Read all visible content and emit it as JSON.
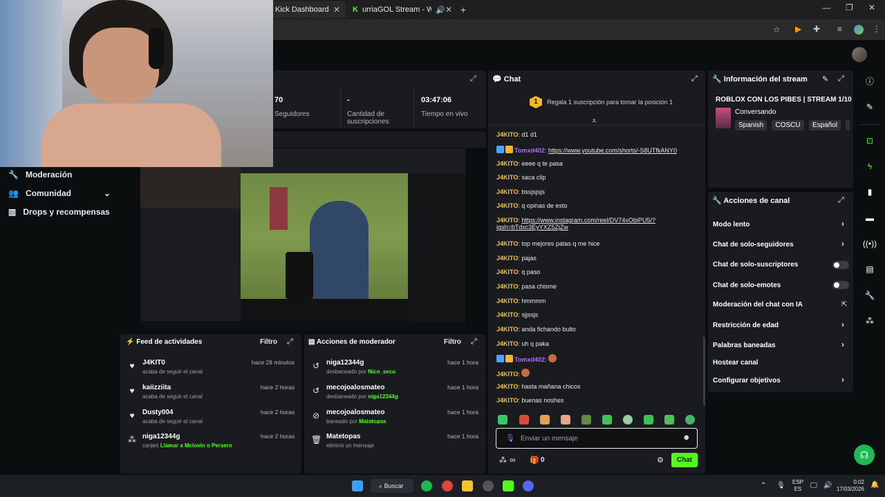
{
  "browser": {
    "tabs": [
      {
        "label": "Kick Dashboard"
      },
      {
        "label": "urriaGOL Stream - Watch Li"
      }
    ]
  },
  "nav": {
    "items": [
      {
        "label": "Moderación"
      },
      {
        "label": "Comunidad"
      },
      {
        "label": "Drops y recompensas"
      }
    ]
  },
  "stats": {
    "followers_value": "70",
    "followers_label": "Seguidores",
    "subs_value": "-",
    "subs_label": "Cantidad de suscripciones",
    "live_value": "03:47:06",
    "live_label": "Tiempo en vivo"
  },
  "activity_feed": {
    "title": "Feed de actividades",
    "filter": "Filtro",
    "items": [
      {
        "name": "J4KIT0",
        "sub": "acaba de seguir el canal",
        "time": "hace 28 minutos",
        "icon": "heart-icon"
      },
      {
        "name": "kaiizziita",
        "sub": "acaba de seguir el canal",
        "time": "hace 2 horas",
        "icon": "heart-icon"
      },
      {
        "name": "Dusty004",
        "sub": "acaba de seguir el canal",
        "time": "hace 2 horas",
        "icon": "heart-icon"
      },
      {
        "name": "niga12344g",
        "sub_prefix": "canjeó",
        "sub_highlight": "Llamar a Mclovin o Persero",
        "time": "hace 2 horas",
        "icon": "points-icon"
      }
    ]
  },
  "mod_actions": {
    "title": "Acciones de moderador",
    "filter": "Filtro",
    "items": [
      {
        "name": "niga12344g",
        "sub_prefix": "desbaneado por",
        "sub_highlight": "Nico_secu",
        "time": "hace 1 hora"
      },
      {
        "name": "mecojoalosmateo",
        "sub_prefix": "desbaneado por",
        "sub_highlight": "niga12344g",
        "time": "hace 1 hora"
      },
      {
        "name": "mecojoalosmateo",
        "sub_prefix": "baneado por",
        "sub_highlight": "Matetopas",
        "time": "hace 1 hora"
      },
      {
        "name": "Matetopas",
        "sub_prefix": "eliminó un mensaje",
        "sub_highlight": "",
        "time": "hace 1 hora"
      }
    ]
  },
  "chat": {
    "title": "Chat",
    "gift_rank": "1",
    "gift_text": "Regala 1 suscripción para tomar la posición 1",
    "messages": [
      {
        "user": "J4KITO",
        "text": "d1 d1"
      },
      {
        "user": "Tomxd402",
        "text": "https://www.youtube.com/shorts/-S8UTfkANY0",
        "link": true,
        "special": true
      },
      {
        "user": "J4KITO",
        "text": "eeee q te pasa"
      },
      {
        "user": "J4KITO",
        "text": "saca clip"
      },
      {
        "user": "J4KITO",
        "text": "bssjsjsjs"
      },
      {
        "user": "J4KITO",
        "text": "q opinas de esto"
      },
      {
        "user": "J4KITO",
        "text": "https://www.instagram.com/reel/DV74vObiPU5/?",
        "text2": "igsh=bTdxc3EyYXZ5ZjZw",
        "link": true
      },
      {
        "user": "J4KITO",
        "text": "top mejores patas q me hice"
      },
      {
        "user": "J4KITO",
        "text": "pajas"
      },
      {
        "user": "J4KITO",
        "text": "q paso"
      },
      {
        "user": "J4KITO",
        "text": "pasa chisme"
      },
      {
        "user": "J4KITO",
        "text": "hmmmm"
      },
      {
        "user": "J4KITO",
        "text": "sjjssjs"
      },
      {
        "user": "J4KITO",
        "text": "anda fichando bulto"
      },
      {
        "user": "J4KITO",
        "text": "uh q paka"
      },
      {
        "user": "Tomxd402",
        "text": "",
        "special": true
      },
      {
        "user": "J4KITO",
        "text": ""
      },
      {
        "user": "J4KITO",
        "text": "hasta mañana chicos"
      },
      {
        "user": "J4KITO",
        "text": "buenas noshes"
      }
    ],
    "input_placeholder": "Enviar un mensaje",
    "points_value": "0",
    "send_label": "Chat",
    "infinity": "∞"
  },
  "stream_info": {
    "title": "Información del stream",
    "stream_title": "ROBLOX CON LOS PIBES | STREAM 1/10",
    "category": "Conversando",
    "tags": [
      "Spanish",
      "COSCU",
      "Español"
    ]
  },
  "channel_actions": {
    "title": "Acciones de canal",
    "items": [
      {
        "label": "Modo lento",
        "control": "chevron"
      },
      {
        "label": "Chat de solo-seguidores",
        "control": "chevron"
      },
      {
        "label": "Chat de solo-suscriptores",
        "control": "toggle"
      },
      {
        "label": "Chat de solo-emotes",
        "control": "toggle"
      },
      {
        "label": "Moderación del chat con IA",
        "control": "external"
      },
      {
        "label": "Restricción de edad",
        "control": "chevron"
      },
      {
        "label": "Palabras baneadas",
        "control": "chevron"
      },
      {
        "label": "Hostear canal",
        "control": "none"
      },
      {
        "label": "Configurar objetivos",
        "control": "chevron"
      }
    ]
  },
  "taskbar": {
    "search_label": "Buscar",
    "lang_top": "ESP",
    "lang_bottom": "ES",
    "time": "0:02",
    "date": "17/03/2026"
  },
  "colors": {
    "accent": "#53fc18",
    "panel": "#191b1f",
    "background": "#0b0e0f",
    "username": "#f5c242",
    "special_username": "#b06bff"
  }
}
